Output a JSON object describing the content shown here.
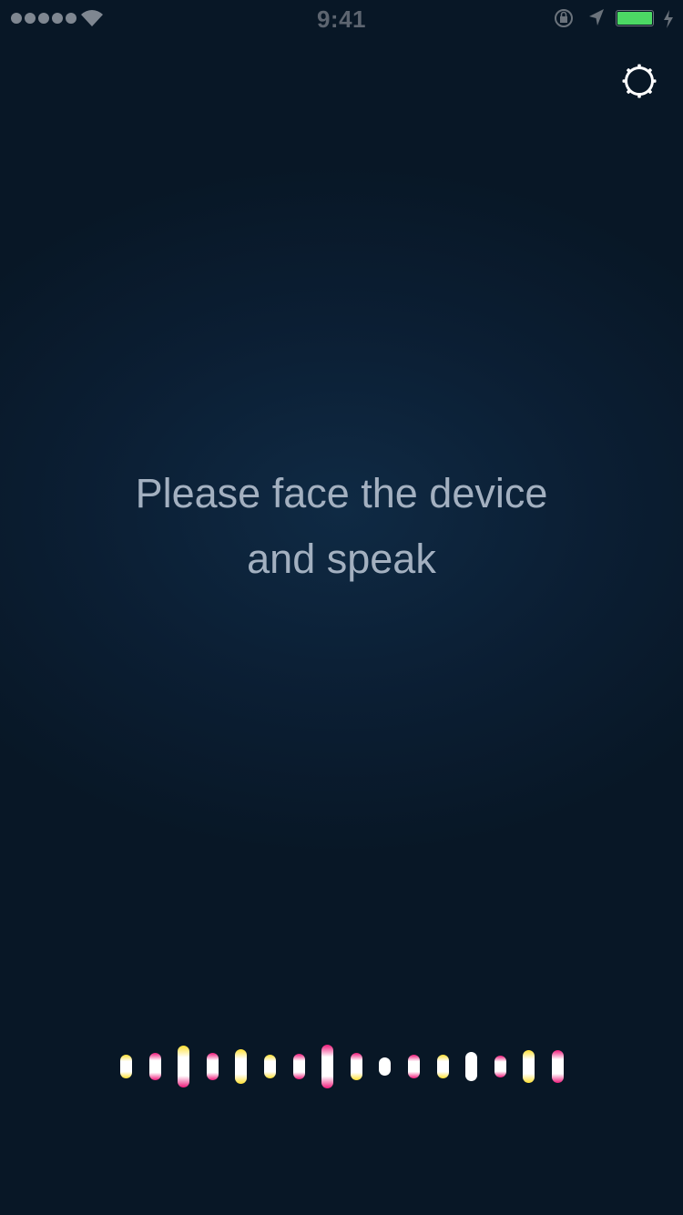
{
  "status_bar": {
    "time": "9:41",
    "signal_icon": "signal-dots-icon",
    "wifi_icon": "wifi-icon",
    "lock_icon": "orientation-lock-icon",
    "location_icon": "location-arrow-icon",
    "battery_icon": "battery-icon",
    "battery_color": "#4cd964",
    "charge_icon": "charging-bolt-icon"
  },
  "settings": {
    "icon": "gear-icon"
  },
  "prompt": {
    "line1": "Please face the device",
    "line2": "and speak"
  },
  "voice_meter": {
    "colors": {
      "core": "#ffffff",
      "accent_yellow": "#ffe033",
      "accent_pink": "#ee1a7a"
    },
    "bars": [
      {
        "level": 0.32,
        "accent": "yellow"
      },
      {
        "level": 0.35,
        "accent": "pink"
      },
      {
        "level": 0.55,
        "accent": "pink-yellow"
      },
      {
        "level": 0.36,
        "accent": "pink"
      },
      {
        "level": 0.45,
        "accent": "yellow"
      },
      {
        "level": 0.31,
        "accent": "yellow"
      },
      {
        "level": 0.33,
        "accent": "pink"
      },
      {
        "level": 0.58,
        "accent": "pink"
      },
      {
        "level": 0.36,
        "accent": "yellow-pink"
      },
      {
        "level": 0.24,
        "accent": "none"
      },
      {
        "level": 0.3,
        "accent": "pink"
      },
      {
        "level": 0.3,
        "accent": "yellow"
      },
      {
        "level": 0.37,
        "accent": "none"
      },
      {
        "level": 0.28,
        "accent": "pink"
      },
      {
        "level": 0.43,
        "accent": "yellow"
      },
      {
        "level": 0.42,
        "accent": "pink"
      }
    ]
  }
}
